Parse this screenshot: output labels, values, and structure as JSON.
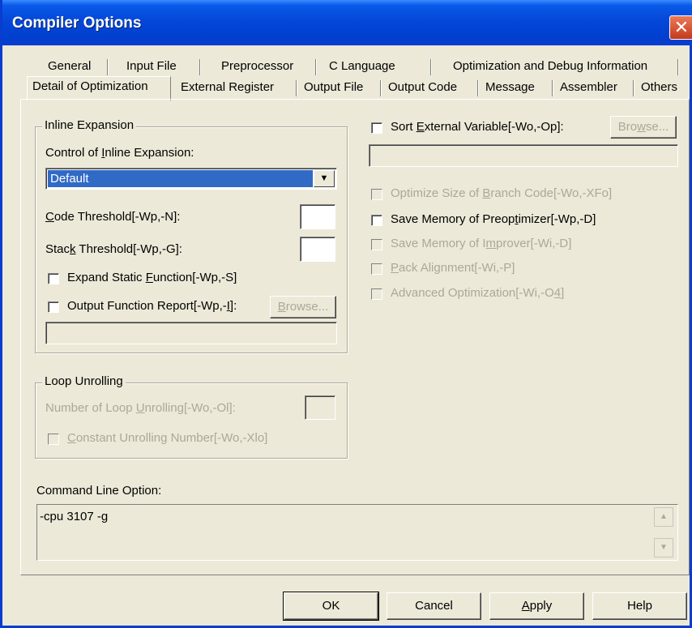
{
  "window": {
    "title": "Compiler Options",
    "close_glyph": "✕"
  },
  "tabs_row1": [
    {
      "label": "General"
    },
    {
      "label": "Input File"
    },
    {
      "label": "Preprocessor"
    },
    {
      "label": "C Language"
    },
    {
      "label": "Optimization and Debug Information"
    }
  ],
  "tabs_row2": [
    {
      "label": "Detail of Optimization",
      "active": true
    },
    {
      "label": "External Register"
    },
    {
      "label": "Output File"
    },
    {
      "label": "Output Code"
    },
    {
      "label": "Message"
    },
    {
      "label": "Assembler"
    },
    {
      "label": "Others"
    }
  ],
  "inline_expansion": {
    "group_label": "Inline Expansion",
    "control_label_pre": "Control of ",
    "control_label_key": "I",
    "control_label_post": "nline Expansion:",
    "control_value": "Default",
    "code_threshold_pre": "",
    "code_threshold_key": "C",
    "code_threshold_post": "ode Threshold[-Wp,-N]:",
    "stack_threshold_pre": "Stac",
    "stack_threshold_key": "k",
    "stack_threshold_post": " Threshold[-Wp,-G]:",
    "expand_static_pre": "Expand Static ",
    "expand_static_key": "F",
    "expand_static_post": "unction[-Wp,-S]",
    "output_report_pre": "Output Function Report[-Wp,-",
    "output_report_key": "I",
    "output_report_post": "]:",
    "browse_pre": "",
    "browse_key": "B",
    "browse_post": "rowse..."
  },
  "loop_unrolling": {
    "group_label": "Loop Unrolling",
    "number_pre": "Number of Loop ",
    "number_key": "U",
    "number_post": "nrolling[-Wo,-Ol]:",
    "constant_pre": "",
    "constant_key": "C",
    "constant_post": "onstant Unrolling Number[-Wo,-Xlo]"
  },
  "right_options": {
    "sort_external_pre": "Sort ",
    "sort_external_key": "E",
    "sort_external_post": "xternal Variable[-Wo,-Op]:",
    "browse_pre": "Bro",
    "browse_key": "w",
    "browse_post": "se...",
    "optimize_branch_pre": "Optimize Size of ",
    "optimize_branch_key": "B",
    "optimize_branch_post": "ranch Code[-Wo,-XFo]",
    "save_preopt_pre": "Save Memory of Preop",
    "save_preopt_key": "t",
    "save_preopt_post": "imizer[-Wp,-D]",
    "save_improver_pre": "Save Memory of I",
    "save_improver_key": "m",
    "save_improver_post": "prover[-Wi,-D]",
    "pack_pre": "",
    "pack_key": "P",
    "pack_post": "ack Alignment[-Wi,-P]",
    "advanced_pre": "Advanced Optimization[-Wi,-O",
    "advanced_key": "4",
    "advanced_post": "]"
  },
  "command_line": {
    "label": "Command Line Option:",
    "value": "-cpu 3107 -g"
  },
  "buttons": {
    "ok": "OK",
    "cancel": "Cancel",
    "apply_pre": "",
    "apply_key": "A",
    "apply_post": "pply",
    "help": "Help"
  },
  "colors": {
    "title_bar": "#0a5ae8",
    "dialog_bg": "#ece9d8",
    "selection": "#316ac5",
    "close_button": "#d4502b"
  },
  "icons": {
    "close": "close-icon",
    "dropdown": "chevron-down-icon",
    "scroll_up": "scroll-up-arrow-icon",
    "scroll_down": "scroll-down-arrow-icon"
  }
}
